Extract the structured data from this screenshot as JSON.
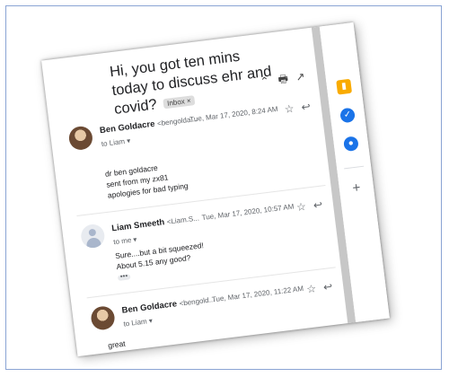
{
  "thread": {
    "subject": "Hi, you got ten mins today to discuss ehr and covid?",
    "label_chip": "Inbox",
    "chip_close": "×"
  },
  "toolbar": {
    "collapse_icon": "⌃",
    "print_icon": "🖶",
    "open_new_window_icon": "↗"
  },
  "messages": [
    {
      "sender_name": "Ben Goldacre",
      "sender_addr": "<bengolda...",
      "recipient": "to Liam ▾",
      "date": "Tue, Mar 17, 2020, 8:24 AM",
      "body": [
        "dr ben goldacre",
        "sent from my zx81",
        "apologies for bad typing"
      ]
    },
    {
      "sender_name": "Liam Smeeth",
      "sender_addr": "<Liam.S...",
      "recipient": "to me ▾",
      "date": "Tue, Mar 17, 2020, 10:57 AM",
      "body": [
        "Sure....but a bit squeezed!",
        "About 5.15 any good?"
      ],
      "ellipsis": "•••"
    },
    {
      "sender_name": "Ben Goldacre",
      "sender_addr": "<bengold...",
      "recipient": "to Liam ▾",
      "date": "Tue, Mar 17, 2020, 11:22 AM",
      "body": [
        "great"
      ]
    }
  ],
  "message_actions": {
    "star": "☆",
    "reply": "↩",
    "more": "⋮"
  },
  "side_panel": {
    "keep_icon": "▮",
    "tasks_icon": "✓",
    "contacts_icon": "●",
    "add_icon": "+",
    "colors": {
      "keep": "#f9ab00",
      "tasks": "#1a73e8",
      "contacts": "#1a73e8"
    }
  }
}
